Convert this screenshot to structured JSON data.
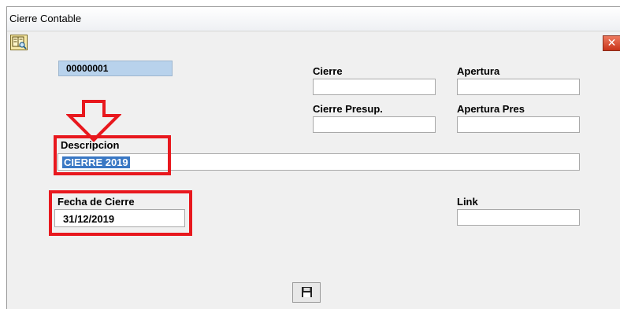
{
  "window": {
    "title": "Cierre Contable"
  },
  "icons": {
    "toolbar": "book-search-icon",
    "close": "close-icon",
    "save": "save-disk-icon",
    "annotation_arrow": "down-arrow-icon"
  },
  "close_glyph": "✕",
  "form": {
    "record_id": "00000001",
    "cierre_label": "Cierre",
    "cierre_value": "",
    "apertura_label": "Apertura",
    "apertura_value": "",
    "cierre_presup_label": "Cierre Presup.",
    "cierre_presup_value": "",
    "apertura_pres_label": "Apertura Pres",
    "apertura_pres_value": "",
    "descripcion_label": "Descripcion",
    "descripcion_value": "CIERRE 2019",
    "fecha_label": "Fecha de Cierre",
    "fecha_value": "31/12/2019",
    "link_label": "Link",
    "link_value": ""
  },
  "colors": {
    "annotation": "#e8181e",
    "selection": "#3a78c4",
    "id_box": "#b8d2ec"
  }
}
